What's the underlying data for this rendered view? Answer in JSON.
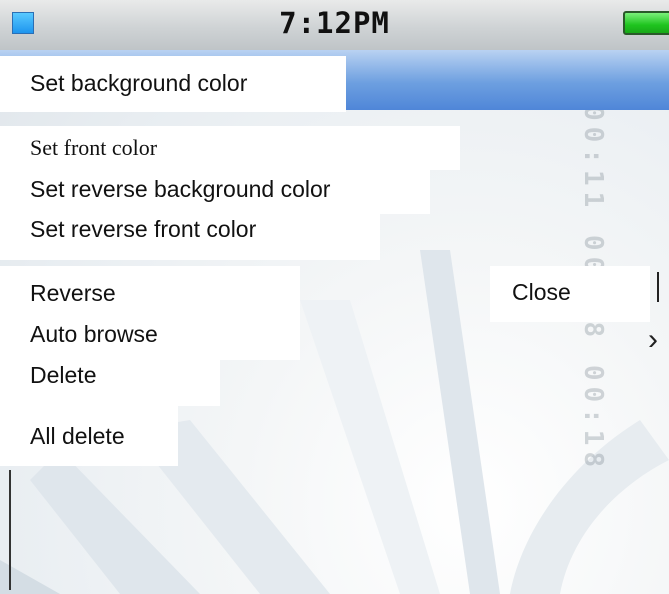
{
  "status_bar": {
    "time": "7:12PM",
    "app_icon": "app-square-icon",
    "battery_icon": "battery-icon",
    "colors": {
      "app_icon": "#2aa7f5",
      "battery": "#22c822"
    }
  },
  "menu": {
    "items": [
      {
        "label": "Set background color"
      },
      {
        "label": "Set front color"
      },
      {
        "label": "Set reverse background color"
      },
      {
        "label": "Set reverse front color"
      },
      {
        "label": "Reverse"
      },
      {
        "label": "Auto browse"
      },
      {
        "label": "Delete"
      },
      {
        "label": "All delete"
      }
    ]
  },
  "submenu": {
    "close": "Close"
  },
  "title_bar_color": "#5b8fdc",
  "watermark": "00:11 00:18 00:18"
}
